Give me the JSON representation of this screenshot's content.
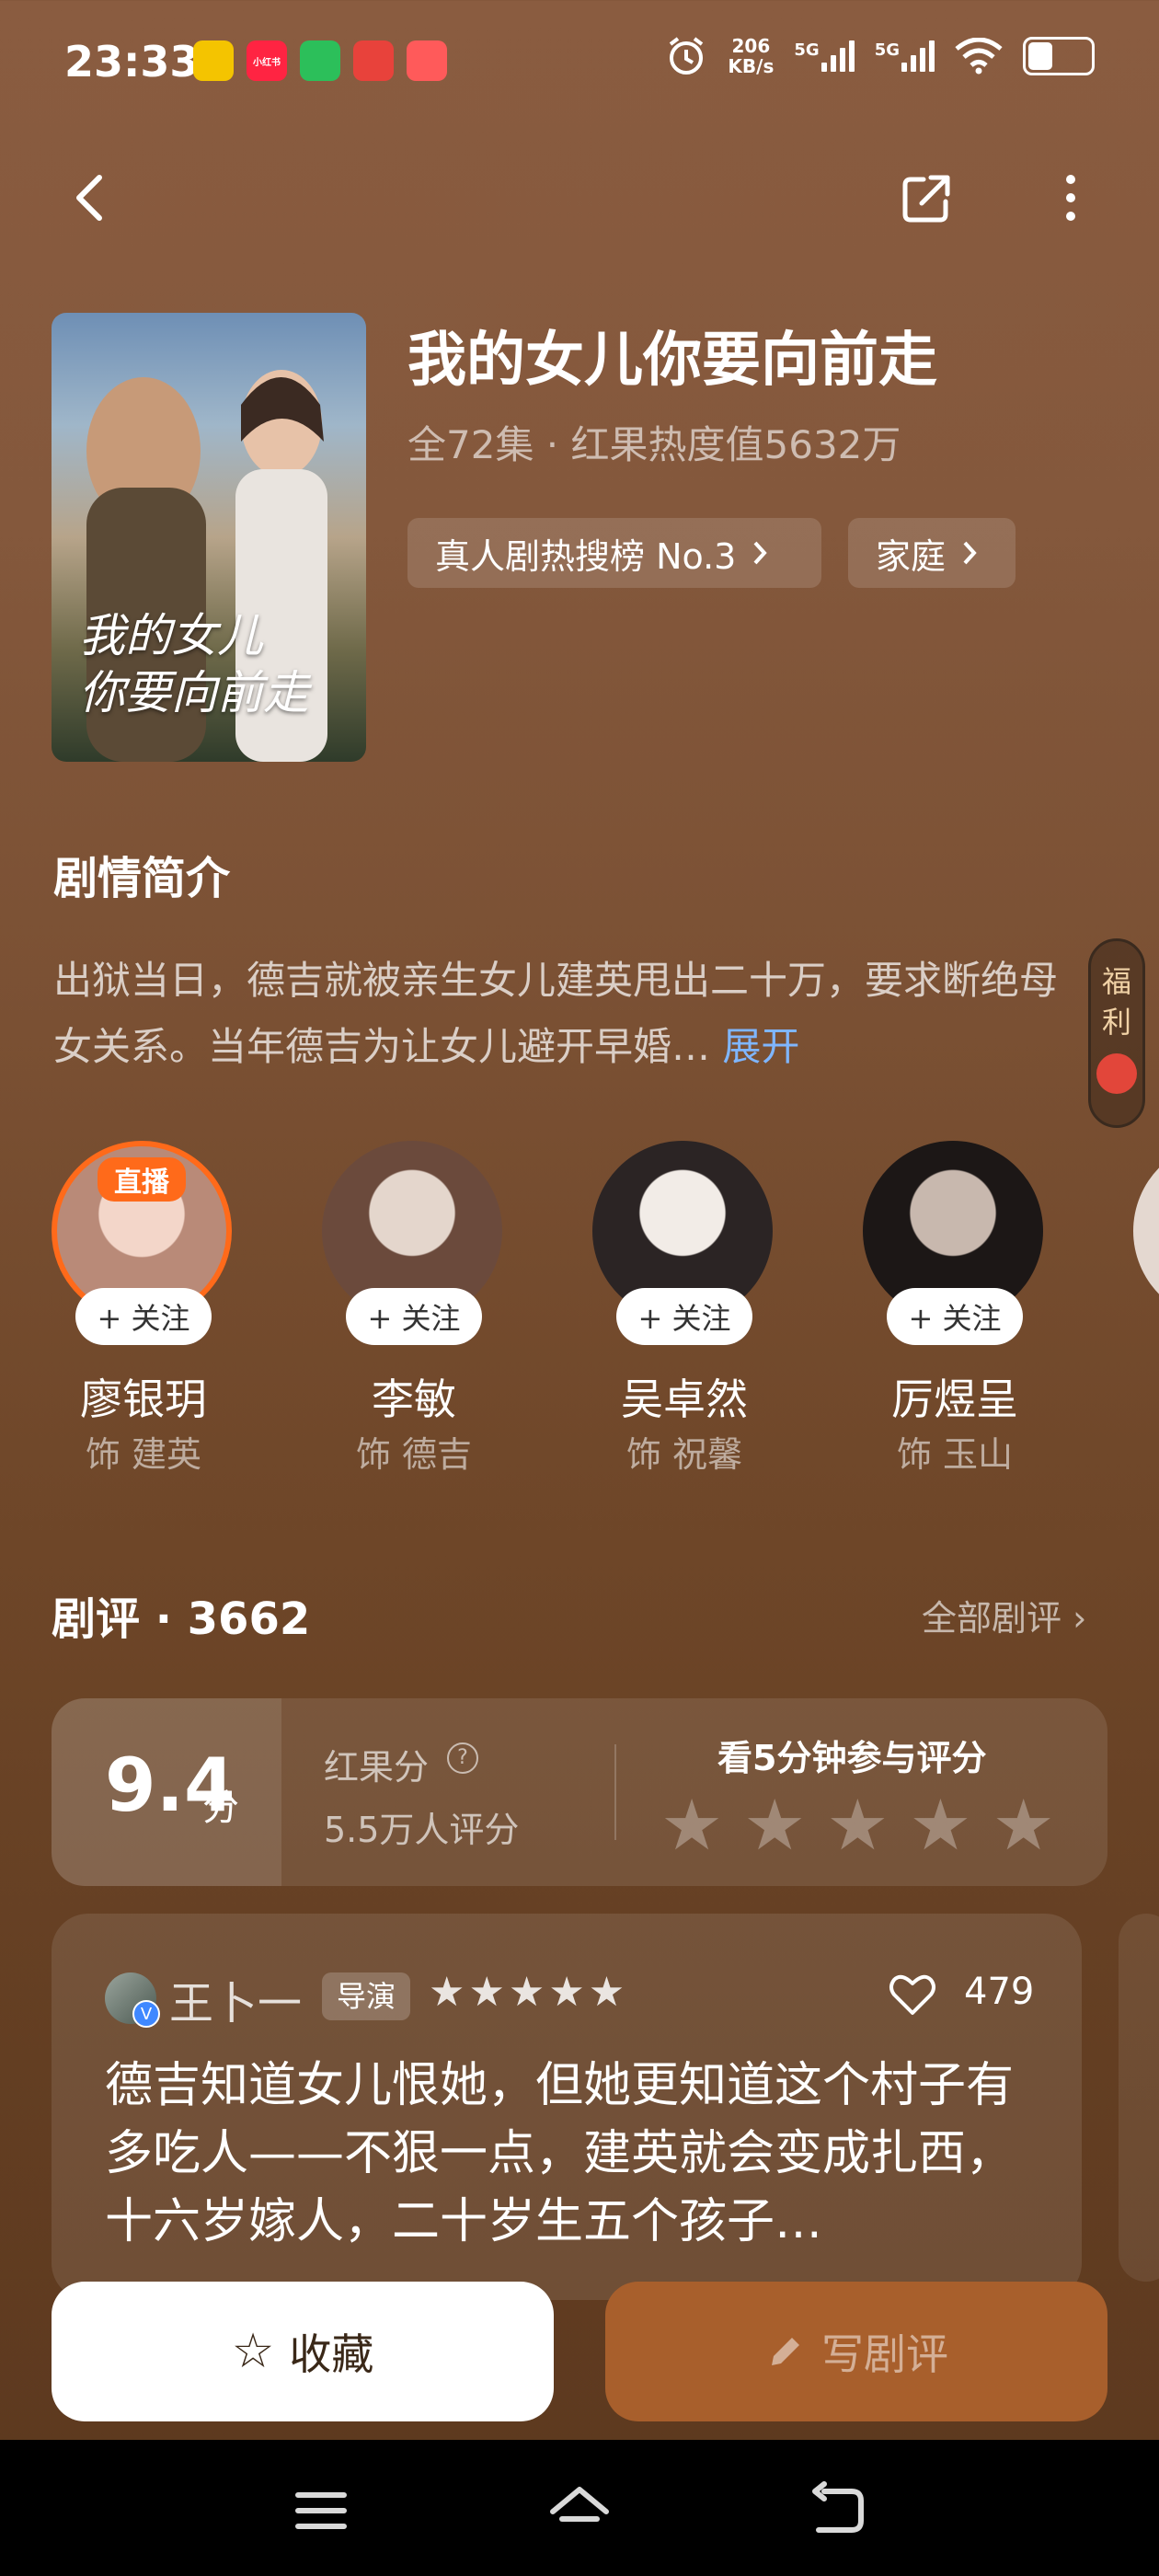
{
  "status_bar": {
    "time": "23:33",
    "app_icons": [
      {
        "name": "weibo-icon",
        "label": "",
        "color": "#f4c400"
      },
      {
        "name": "xiaohongshu-icon",
        "label": "小红书",
        "color": "#ff2442"
      },
      {
        "name": "video-app-icon",
        "label": "",
        "color": "#2cbf5a"
      },
      {
        "name": "red-app-icon",
        "label": "",
        "color": "#e8423b"
      },
      {
        "name": "pig-app-icon",
        "label": "",
        "color": "#ff5a5a"
      }
    ],
    "net_speed_value": "206",
    "net_speed_unit": "KB/s",
    "signal1": "5G",
    "signal2": "5G"
  },
  "show": {
    "poster_text": "我的女儿\n你要向前走",
    "title": "我的女儿你要向前走",
    "subtitle": "全72集 · 红果热度值5632万",
    "tags": [
      {
        "label": "真人剧热搜榜 No.3"
      },
      {
        "label": "家庭"
      }
    ]
  },
  "synopsis": {
    "heading": "剧情简介",
    "text": "出狱当日，德吉就被亲生女儿建英甩出二十万，要求断绝母女关系。当年德吉为让女儿避开早婚…",
    "expand_label": "展开"
  },
  "welfare": {
    "line1": "福",
    "line2": "利"
  },
  "cast": [
    {
      "name": "廖银玥",
      "role": "饰 建英",
      "follow": "+ 关注",
      "live": "直播",
      "colors": [
        "#f3d6c9",
        "#b98a78"
      ]
    },
    {
      "name": "李敏",
      "role": "饰 德吉",
      "follow": "+ 关注",
      "colors": [
        "#e4d6cc",
        "#6b4a3c"
      ]
    },
    {
      "name": "吴卓然",
      "role": "饰 祝馨",
      "follow": "+ 关注",
      "colors": [
        "#f2ece7",
        "#2b2424"
      ]
    },
    {
      "name": "厉煜呈",
      "role": "饰 玉山",
      "follow": "+ 关注",
      "colors": [
        "#c8b8ae",
        "#1c1716"
      ]
    }
  ],
  "reviews": {
    "heading": "剧评 · 3662",
    "all_label": "全部剧评 ›",
    "score": "9.4",
    "score_unit": "分",
    "score_label": "红果分",
    "score_help": "?",
    "rating_count": "5.5万人评分",
    "rate_prompt": "看5分钟参与评分",
    "rate_stars": [
      "★",
      "★",
      "★",
      "★",
      "★"
    ],
    "items": [
      {
        "user": "王卜一",
        "verified": "V",
        "tag": "导演",
        "stars": "★★★★★",
        "likes": "479",
        "text": "德吉知道女儿恨她，但她更知道这个村子有多吃人——不狠一点，建英就会变成扎西，十六岁嫁人，二十岁生五个孩子…"
      }
    ]
  },
  "actions": {
    "favorite_icon": "☆",
    "favorite_label": "收藏",
    "write_label": "写剧评"
  }
}
